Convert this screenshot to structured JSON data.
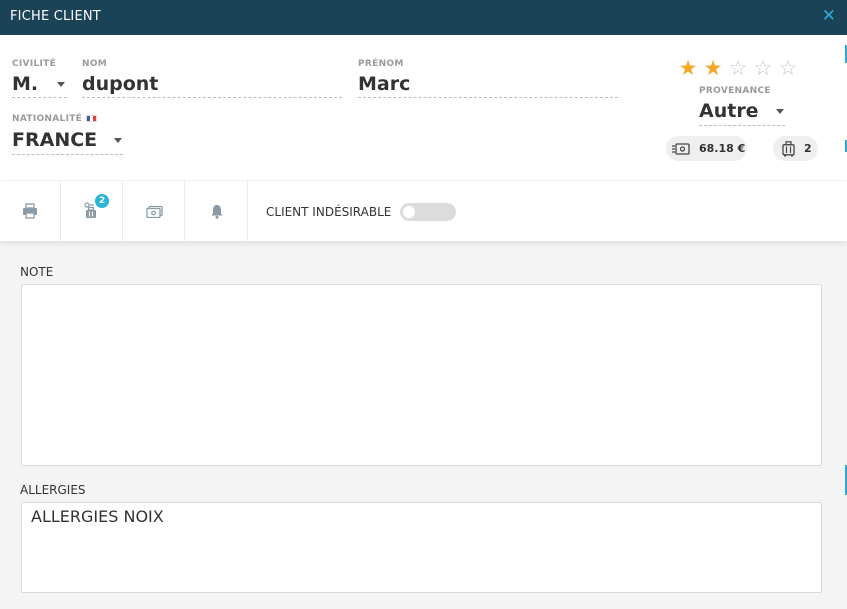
{
  "window": {
    "title": "FICHE CLIENT",
    "close_glyph": "✕"
  },
  "identity": {
    "civilite": {
      "label": "CIVILITÉ",
      "value": "M."
    },
    "nom": {
      "label": "NOM",
      "value": "dupont"
    },
    "prenom": {
      "label": "PRÉNOM",
      "value": "Marc"
    },
    "nationalite": {
      "label": "NATIONALITÉ",
      "value": "FRANCE",
      "flag_colors": [
        "#3b5ca8",
        "#ffffff",
        "#e04040"
      ]
    },
    "provenance": {
      "label": "PROVENANCE",
      "value": "Autre"
    },
    "rating": {
      "value": 2,
      "max": 5,
      "on_color": "#f5a623",
      "off_color": "#c7c7c7"
    },
    "balance": {
      "icon": "money-card-icon",
      "value": "68.18 €"
    },
    "visits": {
      "icon": "luggage-icon",
      "value": "2"
    }
  },
  "toolbar": {
    "print_icon": "printer-icon",
    "luggage_icon": "luggage-icon",
    "luggage_badge": "2",
    "money_icon": "money-card-icon",
    "bell_icon": "bell-icon",
    "undesirable_label": "CLIENT INDÉSIRABLE",
    "undesirable_on": false
  },
  "note": {
    "label": "NOTE",
    "value": ""
  },
  "allergies": {
    "label": "ALLERGIES",
    "value": "ALLERGIES NOIX"
  },
  "colors": {
    "titlebar": "#1b4358",
    "accent": "#2fa8d9",
    "badge": "#29b6d5"
  }
}
